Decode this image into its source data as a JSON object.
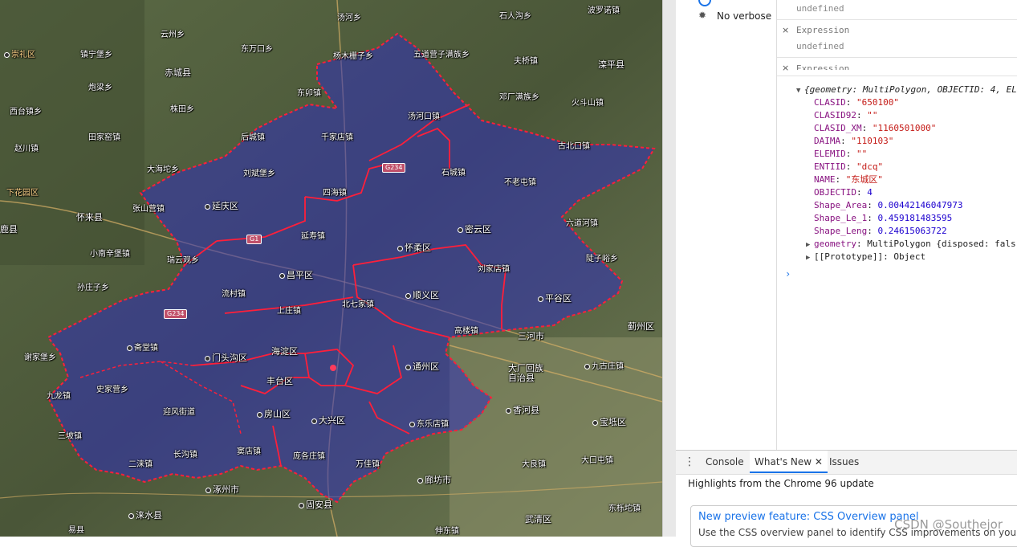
{
  "map": {
    "road_shields": [
      "G234",
      "G1",
      "G234"
    ],
    "labels": [
      "崇礼区",
      "镇宁堡乡",
      "云州乡",
      "汤河乡",
      "石人沟乡",
      "波罗诺镇",
      "东万口乡",
      "五道营子满族乡",
      "杨木栅子乡",
      "夫桥镇",
      "滦平县",
      "赤城县",
      "炮梁乡",
      "东卯镇",
      "邓厂满族乡",
      "火斗山镇",
      "株田乡",
      "西台镇乡",
      "汤河口镇",
      "田家窑镇",
      "后城镇",
      "千家店镇",
      "古北口镇",
      "赵川镇",
      "大海坨乡",
      "G234",
      "刘斌堡乡",
      "石城镇",
      "不老屯镇",
      "下花园区",
      "四海镇",
      "张山营镇",
      "延庆区",
      "六道河镇",
      "怀来县",
      "延寿镇",
      "密云区",
      "鹿县",
      "小南辛堡镇",
      "怀柔区",
      "瑞云观乡",
      "刘家店镇",
      "昌平区",
      "陡子峪乡",
      "孙庄子乡",
      "流村镇",
      "北七家镇",
      "顺义区",
      "平谷区",
      "上庄镇",
      "高楼镇",
      "三河市",
      "蓟州区",
      "谢家堡乡",
      "斋堂镇",
      "门头沟区",
      "海淀区",
      "大厂回族自治县",
      "九龙镇",
      "史家营乡",
      "丰台区",
      "通州区",
      "九古庄镇",
      "迎风街道",
      "房山区",
      "东乐店镇",
      "香河县",
      "宝坻区",
      "大兴区",
      "三坡镇",
      "长沟镇",
      "窦店镇",
      "庞各庄镇",
      "万佳镇",
      "大良镇",
      "大口屯镇",
      "二涞镇",
      "涿州市",
      "廊坊市",
      "固安县",
      "涞水县",
      "东栎坨镇",
      "易县",
      "伸东镇",
      "武清区"
    ]
  },
  "devtools": {
    "left": {
      "items": [
        "No verbose"
      ]
    },
    "watch": [
      {
        "value": "undefined"
      },
      {
        "name": "Expression",
        "value": "undefined"
      },
      {
        "name": "Expression"
      }
    ],
    "object": {
      "header": "{geometry: MultiPolygon, OBJECTID: 4, EL",
      "props": [
        {
          "key": "CLASID",
          "value": "\"650100\"",
          "type": "s"
        },
        {
          "key": "CLASID92",
          "value": "\"\"",
          "type": "s"
        },
        {
          "key": "CLASID_XM",
          "value": "\"1160501000\"",
          "type": "s"
        },
        {
          "key": "DAIMA",
          "value": "\"110103\"",
          "type": "s"
        },
        {
          "key": "ELEMID",
          "value": "\"\"",
          "type": "s"
        },
        {
          "key": "ENTIID",
          "value": "\"dcq\"",
          "type": "s"
        },
        {
          "key": "NAME",
          "value": "\"东城区\"",
          "type": "s"
        },
        {
          "key": "OBJECTID",
          "value": "4",
          "type": "n"
        },
        {
          "key": "Shape_Area",
          "value": "0.00442146047973",
          "type": "n"
        },
        {
          "key": "Shape_Le_1",
          "value": "0.459181483595",
          "type": "n"
        },
        {
          "key": "Shape_Leng",
          "value": "0.24615063722",
          "type": "n"
        }
      ],
      "geometry_row": {
        "key": "geometry",
        "value": "MultiPolygon {disposed: fals"
      },
      "prototype_row": {
        "key": "[[Prototype]]",
        "value": "Object"
      }
    },
    "drawer": {
      "tabs": [
        "Console",
        "What's New",
        "Issues"
      ],
      "active_tab": "What's New",
      "highlights": "Highlights from the Chrome 96 update",
      "card_title": "New preview feature: CSS Overview panel",
      "card_desc": "Use the CSS overview panel to identify CSS improvements on your pa"
    },
    "watermark": "CSDN @Southejor"
  }
}
